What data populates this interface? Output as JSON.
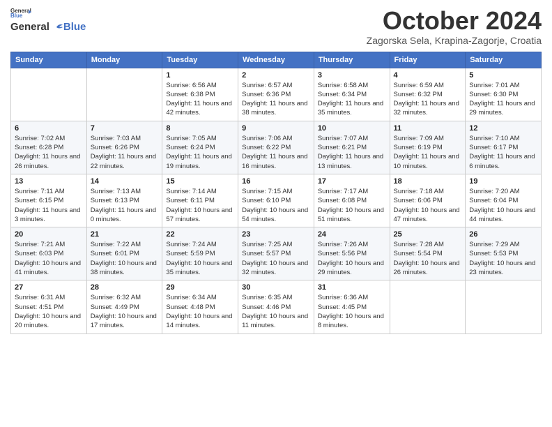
{
  "header": {
    "logo_general": "General",
    "logo_blue": "Blue",
    "month_title": "October 2024",
    "subtitle": "Zagorska Sela, Krapina-Zagorje, Croatia"
  },
  "days_of_week": [
    "Sunday",
    "Monday",
    "Tuesday",
    "Wednesday",
    "Thursday",
    "Friday",
    "Saturday"
  ],
  "weeks": [
    [
      {
        "day": "",
        "info": ""
      },
      {
        "day": "",
        "info": ""
      },
      {
        "day": "1",
        "info": "Sunrise: 6:56 AM\nSunset: 6:38 PM\nDaylight: 11 hours and 42 minutes."
      },
      {
        "day": "2",
        "info": "Sunrise: 6:57 AM\nSunset: 6:36 PM\nDaylight: 11 hours and 38 minutes."
      },
      {
        "day": "3",
        "info": "Sunrise: 6:58 AM\nSunset: 6:34 PM\nDaylight: 11 hours and 35 minutes."
      },
      {
        "day": "4",
        "info": "Sunrise: 6:59 AM\nSunset: 6:32 PM\nDaylight: 11 hours and 32 minutes."
      },
      {
        "day": "5",
        "info": "Sunrise: 7:01 AM\nSunset: 6:30 PM\nDaylight: 11 hours and 29 minutes."
      }
    ],
    [
      {
        "day": "6",
        "info": "Sunrise: 7:02 AM\nSunset: 6:28 PM\nDaylight: 11 hours and 26 minutes."
      },
      {
        "day": "7",
        "info": "Sunrise: 7:03 AM\nSunset: 6:26 PM\nDaylight: 11 hours and 22 minutes."
      },
      {
        "day": "8",
        "info": "Sunrise: 7:05 AM\nSunset: 6:24 PM\nDaylight: 11 hours and 19 minutes."
      },
      {
        "day": "9",
        "info": "Sunrise: 7:06 AM\nSunset: 6:22 PM\nDaylight: 11 hours and 16 minutes."
      },
      {
        "day": "10",
        "info": "Sunrise: 7:07 AM\nSunset: 6:21 PM\nDaylight: 11 hours and 13 minutes."
      },
      {
        "day": "11",
        "info": "Sunrise: 7:09 AM\nSunset: 6:19 PM\nDaylight: 11 hours and 10 minutes."
      },
      {
        "day": "12",
        "info": "Sunrise: 7:10 AM\nSunset: 6:17 PM\nDaylight: 11 hours and 6 minutes."
      }
    ],
    [
      {
        "day": "13",
        "info": "Sunrise: 7:11 AM\nSunset: 6:15 PM\nDaylight: 11 hours and 3 minutes."
      },
      {
        "day": "14",
        "info": "Sunrise: 7:13 AM\nSunset: 6:13 PM\nDaylight: 11 hours and 0 minutes."
      },
      {
        "day": "15",
        "info": "Sunrise: 7:14 AM\nSunset: 6:11 PM\nDaylight: 10 hours and 57 minutes."
      },
      {
        "day": "16",
        "info": "Sunrise: 7:15 AM\nSunset: 6:10 PM\nDaylight: 10 hours and 54 minutes."
      },
      {
        "day": "17",
        "info": "Sunrise: 7:17 AM\nSunset: 6:08 PM\nDaylight: 10 hours and 51 minutes."
      },
      {
        "day": "18",
        "info": "Sunrise: 7:18 AM\nSunset: 6:06 PM\nDaylight: 10 hours and 47 minutes."
      },
      {
        "day": "19",
        "info": "Sunrise: 7:20 AM\nSunset: 6:04 PM\nDaylight: 10 hours and 44 minutes."
      }
    ],
    [
      {
        "day": "20",
        "info": "Sunrise: 7:21 AM\nSunset: 6:03 PM\nDaylight: 10 hours and 41 minutes."
      },
      {
        "day": "21",
        "info": "Sunrise: 7:22 AM\nSunset: 6:01 PM\nDaylight: 10 hours and 38 minutes."
      },
      {
        "day": "22",
        "info": "Sunrise: 7:24 AM\nSunset: 5:59 PM\nDaylight: 10 hours and 35 minutes."
      },
      {
        "day": "23",
        "info": "Sunrise: 7:25 AM\nSunset: 5:57 PM\nDaylight: 10 hours and 32 minutes."
      },
      {
        "day": "24",
        "info": "Sunrise: 7:26 AM\nSunset: 5:56 PM\nDaylight: 10 hours and 29 minutes."
      },
      {
        "day": "25",
        "info": "Sunrise: 7:28 AM\nSunset: 5:54 PM\nDaylight: 10 hours and 26 minutes."
      },
      {
        "day": "26",
        "info": "Sunrise: 7:29 AM\nSunset: 5:53 PM\nDaylight: 10 hours and 23 minutes."
      }
    ],
    [
      {
        "day": "27",
        "info": "Sunrise: 6:31 AM\nSunset: 4:51 PM\nDaylight: 10 hours and 20 minutes."
      },
      {
        "day": "28",
        "info": "Sunrise: 6:32 AM\nSunset: 4:49 PM\nDaylight: 10 hours and 17 minutes."
      },
      {
        "day": "29",
        "info": "Sunrise: 6:34 AM\nSunset: 4:48 PM\nDaylight: 10 hours and 14 minutes."
      },
      {
        "day": "30",
        "info": "Sunrise: 6:35 AM\nSunset: 4:46 PM\nDaylight: 10 hours and 11 minutes."
      },
      {
        "day": "31",
        "info": "Sunrise: 6:36 AM\nSunset: 4:45 PM\nDaylight: 10 hours and 8 minutes."
      },
      {
        "day": "",
        "info": ""
      },
      {
        "day": "",
        "info": ""
      }
    ]
  ]
}
